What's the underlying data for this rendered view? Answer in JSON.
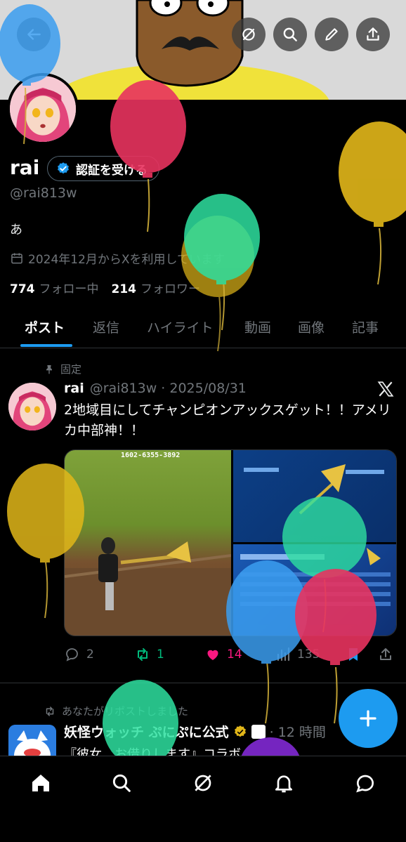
{
  "header": {
    "back_icon": "arrow-left-icon",
    "actions": [
      "grok-icon",
      "search-icon",
      "edit-icon",
      "share-icon"
    ]
  },
  "profile": {
    "display_name": "rai",
    "verify_label": "認証を受ける",
    "handle": "@rai813w",
    "bio": "あ",
    "joined": "2024年12月からXを利用しています",
    "following_count": "774",
    "following_label": "フォロー中",
    "followers_count": "214",
    "followers_label": "フォロワー"
  },
  "tabs": [
    "ポスト",
    "返信",
    "ハイライト",
    "動画",
    "画像",
    "記事"
  ],
  "pinned_post": {
    "pinned_label": "固定",
    "name": "rai",
    "meta": "@rai813w · 2025/08/31",
    "text": "2地域目にしてチャンピオンアックスゲット！！アメリカ中部神！！",
    "image_caption": "1602-6355-3892",
    "replies": "2",
    "reposts": "1",
    "likes": "14",
    "views": "135"
  },
  "repost": {
    "note": "あなたがリポストしました",
    "name": "妖怪ウォッチ ぷにぷに公式",
    "meta": "· 12 時間",
    "text": "『彼女、お借りします』コラボ"
  },
  "colors": {
    "accent": "#1d9bf0",
    "like": "#f91880",
    "repost": "#00ba7c",
    "background": "#000000"
  },
  "nav": [
    "home-icon",
    "search-icon",
    "grok-icon",
    "notifications-icon",
    "messages-icon"
  ]
}
